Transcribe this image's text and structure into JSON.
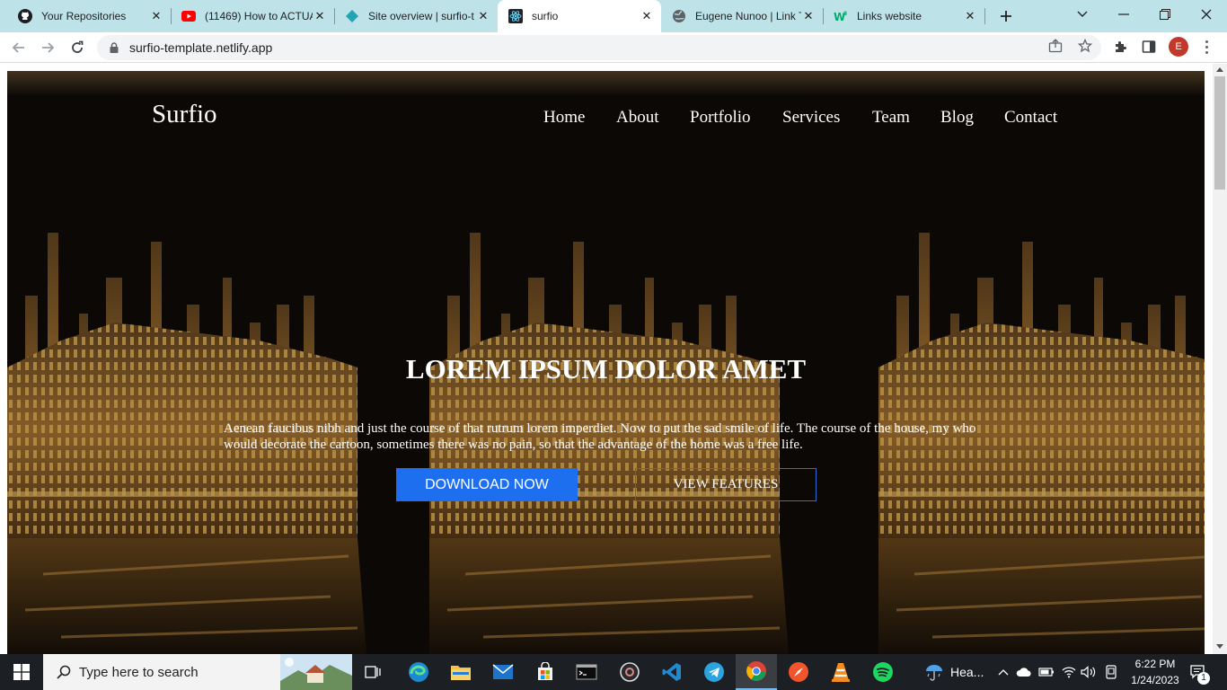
{
  "browser": {
    "tabs": [
      {
        "title": "Your Repositories",
        "icon": "github-icon"
      },
      {
        "title": "(11469) How to ACTUA",
        "icon": "youtube-icon"
      },
      {
        "title": "Site overview | surfio-t",
        "icon": "netlify-icon"
      },
      {
        "title": "surfio",
        "icon": "react-icon",
        "active": true
      },
      {
        "title": "Eugene Nunoo | Link T",
        "icon": "globe-icon"
      },
      {
        "title": "Links website",
        "icon": "w3schools-icon"
      }
    ],
    "url": "surfio-template.netlify.app",
    "profile_initial": "E"
  },
  "page": {
    "brand": "Surfio",
    "nav": [
      "Home",
      "About",
      "Portfolio",
      "Services",
      "Team",
      "Blog",
      "Contact"
    ],
    "hero": {
      "title": "LOREM IPSUM DOLOR AMET",
      "text": "Aenean faucibus nibh and just the course of that rutrum lorem imperdiet. Now to put the sad smile of life. The course of the house, my who would decorate the cartoon, sometimes there was no pain, so that the advantage of the home was a free life.",
      "primary_button": "DOWNLOAD NOW",
      "secondary_button": "VIEW FEATURES"
    }
  },
  "taskbar": {
    "search_placeholder": "Type here to search",
    "weather": "Hea...",
    "time": "6:22 PM",
    "date": "1/24/2023",
    "notification_count": "1"
  },
  "colors": {
    "tabstrip": "#bde3e9",
    "primary_button": "#1e6ff0",
    "taskbar": "#1c1f24"
  }
}
